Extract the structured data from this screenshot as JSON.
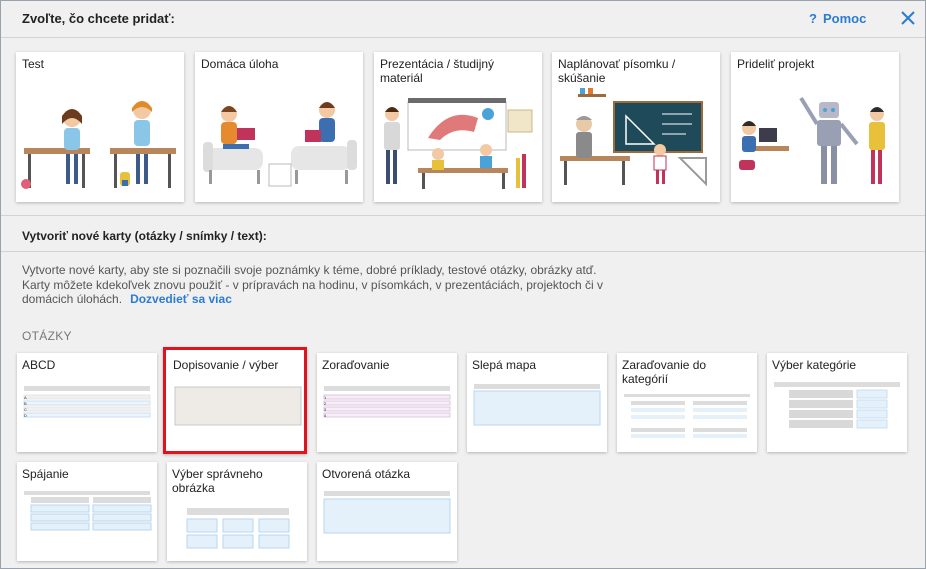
{
  "header": {
    "title": "Zvoľte, čo chcete pridať:",
    "help_icon": "?",
    "help_label": "Pomoc"
  },
  "top_cards": [
    {
      "label": "Test",
      "icon": "classroom-test-illustration"
    },
    {
      "label": "Domáca úloha",
      "icon": "homework-illustration"
    },
    {
      "label": "Prezentácia / študijný materiál",
      "icon": "presentation-illustration"
    },
    {
      "label": "Naplánovať písomku / skúšanie",
      "icon": "exam-planning-illustration"
    },
    {
      "label": "Prideliť projekt",
      "icon": "project-robot-illustration"
    }
  ],
  "cards_section": {
    "title": "Vytvoriť nové karty (otázky / snímky / text):",
    "description": "Vytvorte nové karty, aby ste si poznačili svoje poznámky k téme, dobré príklady, testové otázky, obrázky atď. Karty môžete kdekoľvek znovu použiť - v prípravách na hodinu, v písomkách, v prezentáciách, projektoch či v domácich úlohách.",
    "learn_more": "Dozvedieť sa viac",
    "group_label": "OTÁZKY"
  },
  "question_types": [
    {
      "label": "ABCD",
      "selected": false
    },
    {
      "label": "Dopisovanie / výber",
      "selected": true
    },
    {
      "label": "Zoraďovanie",
      "selected": false
    },
    {
      "label": "Slepá mapa",
      "selected": false
    },
    {
      "label": "Zaraďovanie do kategórií",
      "selected": false
    },
    {
      "label": "Výber kategórie",
      "selected": false
    },
    {
      "label": "Spájanie",
      "selected": false
    },
    {
      "label": "Výber správneho obrázka",
      "selected": false
    },
    {
      "label": "Otvorená otázka",
      "selected": false
    }
  ],
  "colors": {
    "accent": "#2b7cd3",
    "selection": "#e0141e",
    "background": "#f0f0f0"
  }
}
